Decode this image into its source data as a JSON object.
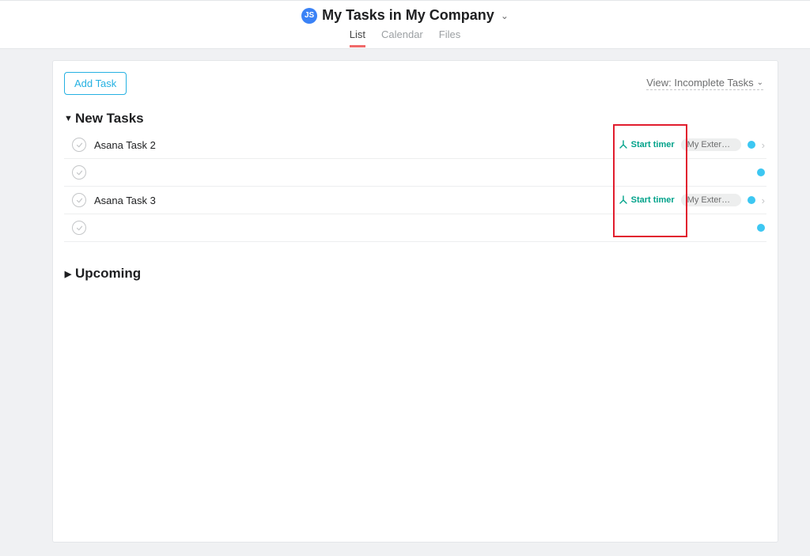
{
  "header": {
    "avatar_initials": "JS",
    "title": "My Tasks in My Company",
    "tabs": {
      "list": "List",
      "calendar": "Calendar",
      "files": "Files"
    },
    "active_tab": "list"
  },
  "toolbar": {
    "add_task_label": "Add Task",
    "view_label": "View: Incomplete Tasks"
  },
  "sections": {
    "new_tasks": {
      "label": "New Tasks",
      "expanded": true
    },
    "upcoming": {
      "label": "Upcoming",
      "expanded": false
    }
  },
  "tasks": [
    {
      "title": "Asana Task 2",
      "has_timer": true,
      "timer_label": "Start timer",
      "project_tag": "My Extern…",
      "has_project": true,
      "has_dot": true,
      "has_caret": true
    },
    {
      "title": "",
      "has_timer": false,
      "has_project": false,
      "has_dot": true,
      "has_caret": false
    },
    {
      "title": "Asana Task 3",
      "has_timer": true,
      "timer_label": "Start timer",
      "project_tag": "My Extern…",
      "has_project": true,
      "has_dot": true,
      "has_caret": true
    },
    {
      "title": "",
      "has_timer": false,
      "has_project": false,
      "has_dot": true,
      "has_caret": false
    }
  ],
  "colors": {
    "accent_blue": "#25b1e2",
    "dot": "#3dc7f2",
    "timer_green": "#00a28a",
    "tab_active": "#f06a6a",
    "red_highlight": "#e11d2e"
  }
}
